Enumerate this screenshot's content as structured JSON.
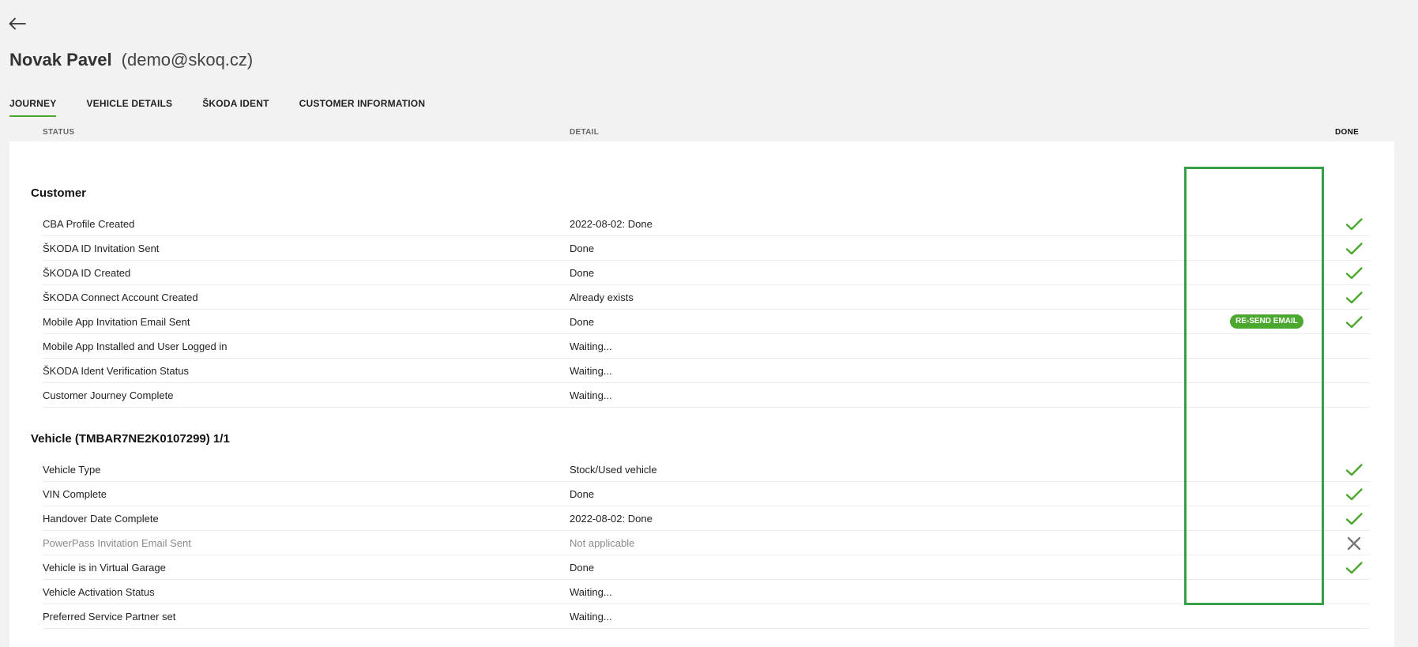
{
  "header": {
    "name": "Novak Pavel",
    "email": "(demo@skoq.cz)"
  },
  "tabs": [
    {
      "label": "JOURNEY",
      "active": true
    },
    {
      "label": "VEHICLE DETAILS",
      "active": false
    },
    {
      "label": "ŠKODA IDENT",
      "active": false
    },
    {
      "label": "CUSTOMER INFORMATION",
      "active": false
    }
  ],
  "columns": {
    "status": "STATUS",
    "detail": "DETAIL",
    "done": "DONE"
  },
  "sections": [
    {
      "title": "Customer",
      "rows": [
        {
          "status": "CBA Profile Created",
          "detail": "2022-08-02: Done",
          "done": "check"
        },
        {
          "status": "ŠKODA ID Invitation Sent",
          "detail": "Done",
          "done": "check"
        },
        {
          "status": "ŠKODA ID Created",
          "detail": "Done",
          "done": "check"
        },
        {
          "status": "ŠKODA Connect Account Created",
          "detail": "Already exists",
          "done": "check"
        },
        {
          "status": "Mobile App Invitation Email Sent",
          "detail": "Done",
          "done": "check",
          "action": "RE-SEND EMAIL"
        },
        {
          "status": "Mobile App Installed and User Logged in",
          "detail": "Waiting...",
          "done": ""
        },
        {
          "status": "ŠKODA Ident Verification Status",
          "detail": "Waiting...",
          "done": ""
        },
        {
          "status": "Customer Journey Complete",
          "detail": "Waiting...",
          "done": ""
        }
      ]
    },
    {
      "title": "Vehicle (TMBAR7NE2K0107299) 1/1",
      "rows": [
        {
          "status": "Vehicle Type",
          "detail": "Stock/Used vehicle",
          "done": "check"
        },
        {
          "status": "VIN Complete",
          "detail": "Done",
          "done": "check"
        },
        {
          "status": "Handover Date Complete",
          "detail": "2022-08-02: Done",
          "done": "check"
        },
        {
          "status": "PowerPass Invitation Email Sent",
          "detail": "Not applicable",
          "done": "cross",
          "muted": true
        },
        {
          "status": "Vehicle is in Virtual Garage",
          "detail": "Done",
          "done": "check"
        },
        {
          "status": "Vehicle Activation Status",
          "detail": "Waiting...",
          "done": ""
        },
        {
          "status": "Preferred Service Partner set",
          "detail": "Waiting...",
          "done": ""
        }
      ]
    }
  ],
  "colors": {
    "accent": "#4ba82e",
    "highlight": "#35a048",
    "cross": "#777777"
  }
}
